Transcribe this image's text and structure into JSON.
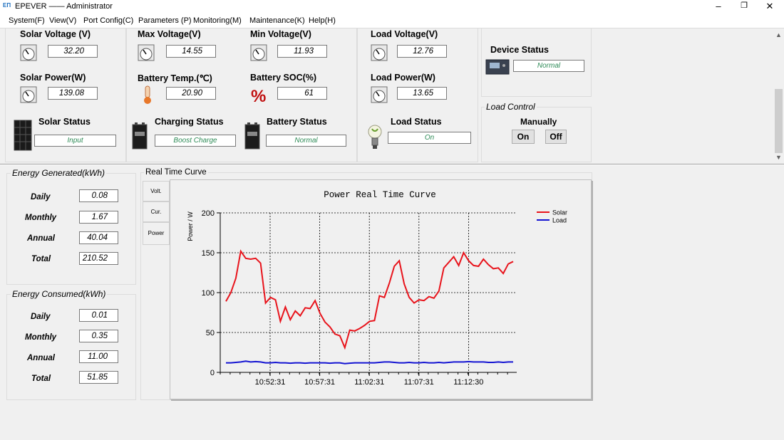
{
  "window": {
    "title": "EPEVER —— Administrator",
    "app_icon": "epever-logo-icon"
  },
  "menu": [
    "System(F)",
    "View(V)",
    "Port Config(C)",
    "Parameters (P)",
    "Monitoring(M)",
    "Maintenance(K)",
    "Help(H)"
  ],
  "readings": {
    "solar_voltage": {
      "label": "Solar Voltage (V)",
      "value": "32.20"
    },
    "solar_power": {
      "label": "Solar Power(W)",
      "value": "139.08"
    },
    "max_voltage": {
      "label": "Max Voltage(V)",
      "value": "14.55"
    },
    "battery_temp": {
      "label": "Battery Temp.(℃)",
      "value": "20.90"
    },
    "min_voltage": {
      "label": "Min Voltage(V)",
      "value": "11.93"
    },
    "battery_soc": {
      "label": "Battery SOC(%)",
      "value": "61"
    },
    "load_voltage": {
      "label": "Load Voltage(V)",
      "value": "12.76"
    },
    "load_power": {
      "label": "Load Power(W)",
      "value": "13.65"
    }
  },
  "statuses": {
    "solar": {
      "label": "Solar Status",
      "value": "Input"
    },
    "charging": {
      "label": "Charging Status",
      "value": "Boost Charge"
    },
    "battery": {
      "label": "Battery Status",
      "value": "Normal"
    },
    "load": {
      "label": "Load Status",
      "value": "On"
    },
    "device": {
      "label": "Device Status",
      "value": "Normal"
    }
  },
  "load_control": {
    "title": "Load Control",
    "mode": "Manually",
    "on_label": "On",
    "off_label": "Off"
  },
  "energy_generated": {
    "title": "Energy Generated(kWh)",
    "rows": [
      {
        "label": "Daily",
        "value": "0.08"
      },
      {
        "label": "Monthly",
        "value": "1.67"
      },
      {
        "label": "Annual",
        "value": "40.04"
      },
      {
        "label": "Total",
        "value": "210.52"
      }
    ]
  },
  "energy_consumed": {
    "title": "Energy Consumed(kWh)",
    "rows": [
      {
        "label": "Daily",
        "value": "0.01"
      },
      {
        "label": "Monthly",
        "value": "0.35"
      },
      {
        "label": "Annual",
        "value": "11.00"
      },
      {
        "label": "Total",
        "value": "51.85"
      }
    ]
  },
  "curve": {
    "section_title": "Real Time Curve",
    "tabs": [
      "Volt.",
      "Cur.",
      "Power"
    ]
  },
  "colors": {
    "status_text": "#2e8b57",
    "solar_line": "#e8141c",
    "load_line": "#1414d2"
  },
  "chart_data": {
    "type": "line",
    "title": "Power Real Time Curve",
    "xlabel": "",
    "ylabel": "Power / W",
    "ylim": [
      0,
      200
    ],
    "yticks": [
      0,
      50,
      100,
      150,
      200
    ],
    "xticks": [
      "10:52:31",
      "10:57:31",
      "11:02:31",
      "11:07:31",
      "11:12:30"
    ],
    "grid": true,
    "legend_position": "top-right",
    "series": [
      {
        "name": "Solar",
        "color": "#e8141c",
        "values": [
          89,
          100,
          118,
          152,
          143,
          142,
          143,
          137,
          87,
          94,
          91,
          64,
          82,
          66,
          77,
          71,
          81,
          80,
          90,
          74,
          63,
          57,
          48,
          46,
          31,
          53,
          52,
          55,
          59,
          64,
          65,
          96,
          94,
          112,
          133,
          140,
          111,
          94,
          87,
          91,
          90,
          95,
          93,
          102,
          131,
          138,
          145,
          134,
          150,
          140,
          134,
          133,
          142,
          135,
          130,
          131,
          124,
          136,
          139
        ]
      },
      {
        "name": "Load",
        "color": "#1414d2",
        "values": [
          12,
          12,
          12.5,
          13,
          14,
          13,
          13.5,
          13,
          12,
          12,
          12.5,
          12,
          12,
          11.5,
          12,
          12,
          11.5,
          12,
          12,
          12,
          12,
          11.5,
          12,
          12,
          11,
          11.5,
          12,
          12,
          12,
          12,
          12,
          12.5,
          13,
          13,
          12.5,
          12,
          12,
          12.5,
          12,
          12,
          12.5,
          12,
          12,
          12.5,
          12,
          12.5,
          13,
          13,
          13,
          13.5,
          13,
          13,
          13,
          12.5,
          12.5,
          13,
          12.5,
          13,
          13
        ]
      }
    ]
  }
}
